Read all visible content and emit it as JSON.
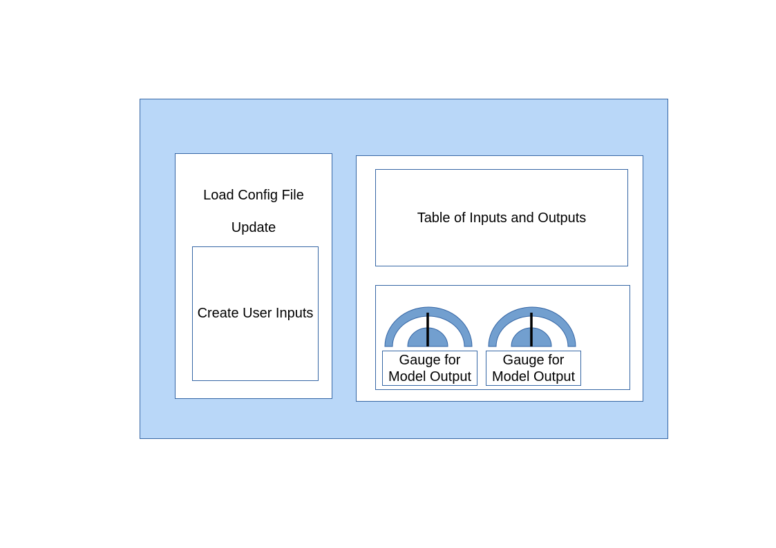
{
  "colors": {
    "panel_fill": "#b9d7f8",
    "border": "#3465a4",
    "gauge_fill": "#729fcf",
    "needle": "#000000"
  },
  "left_panel": {
    "load_config_label": "Load Config File",
    "update_label": "Update",
    "user_inputs_label": "Create User Inputs"
  },
  "right_panel": {
    "table_label": "Table of Inputs and Outputs",
    "gauges": [
      {
        "caption_line1": "Gauge for",
        "caption_line2": "Model Output"
      },
      {
        "caption_line1": "Gauge for",
        "caption_line2": "Model Output"
      }
    ]
  }
}
